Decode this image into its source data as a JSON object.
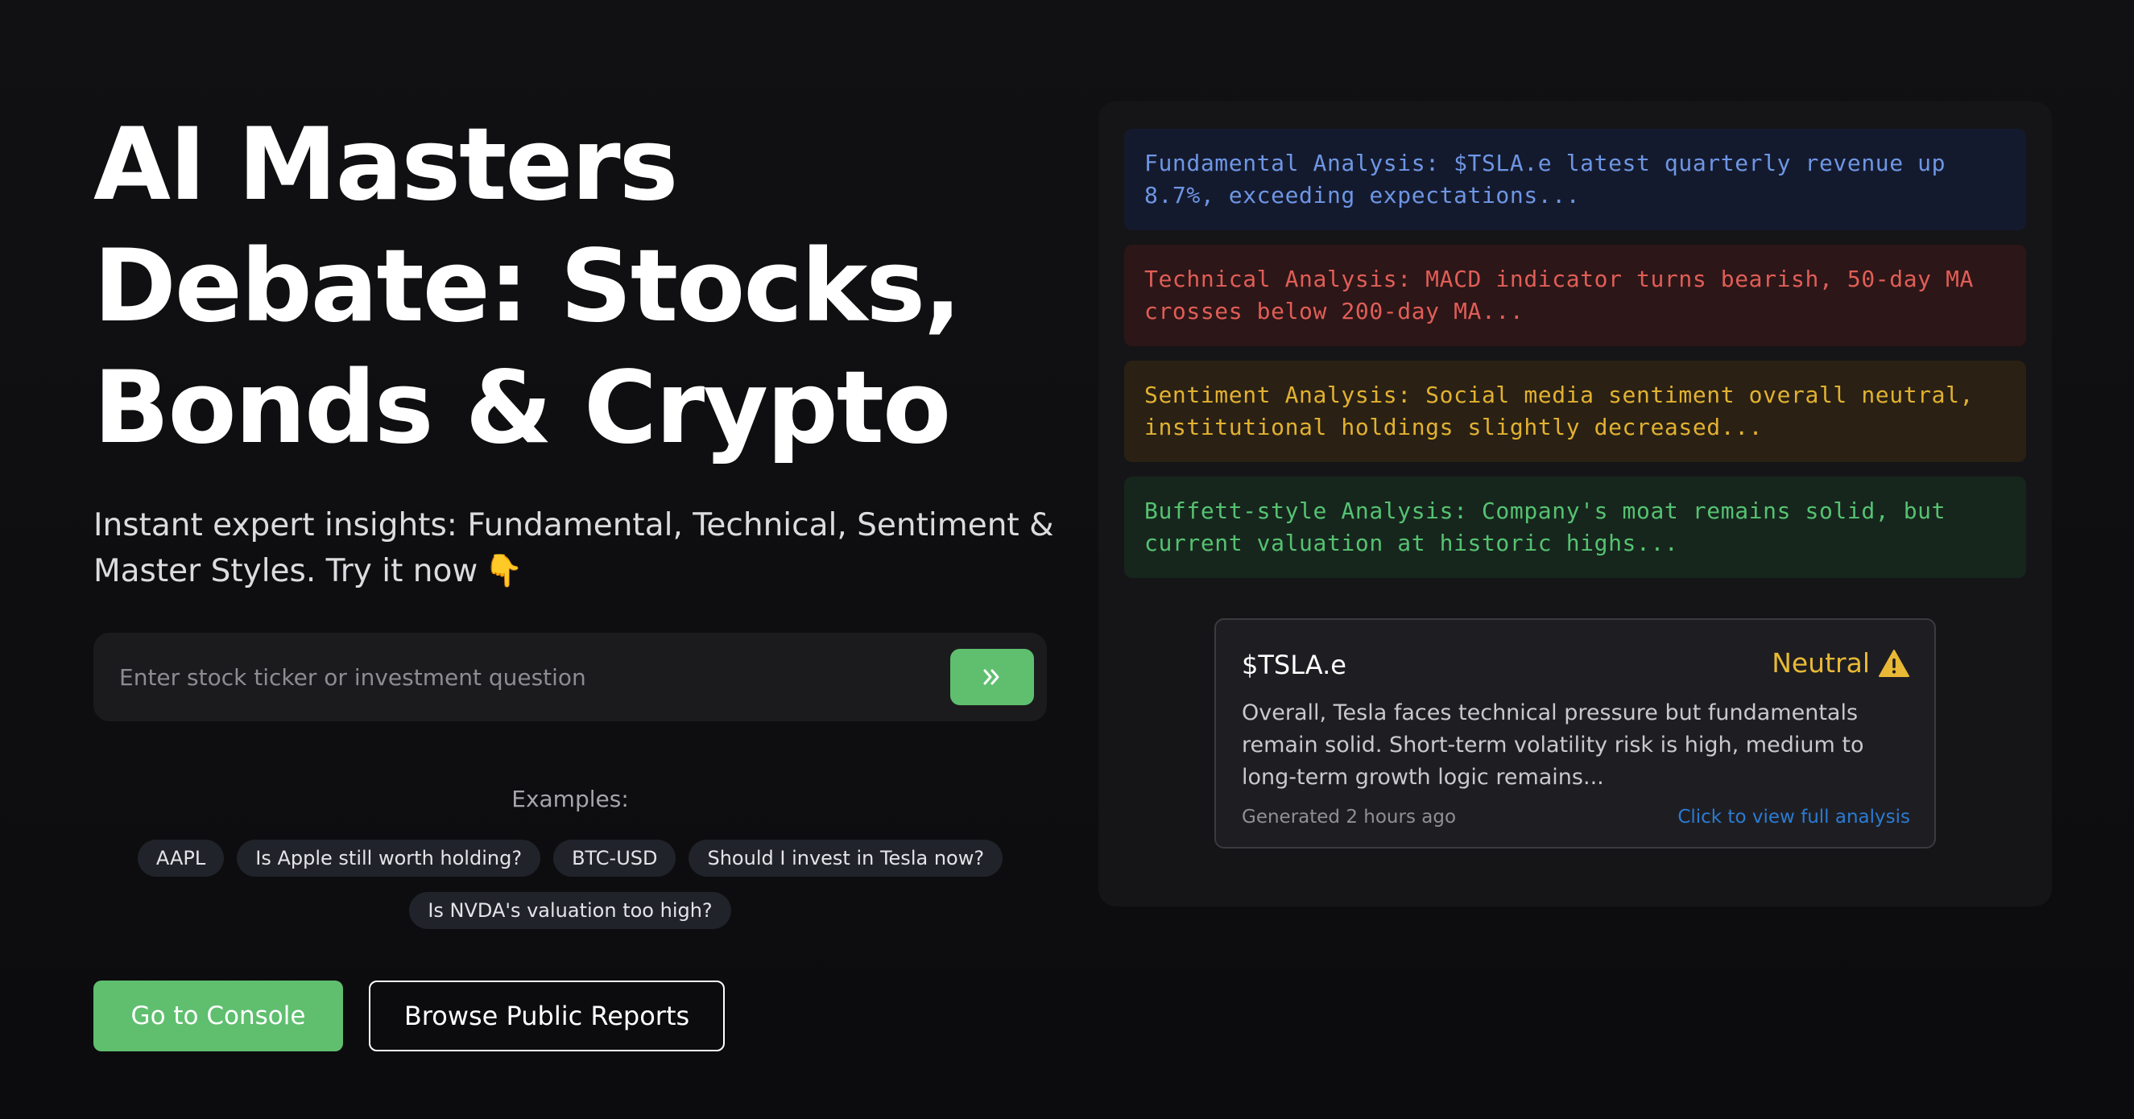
{
  "hero": {
    "title": "AI Masters Debate: Stocks, Bonds & Crypto",
    "subtitle": "Instant expert insights: Fundamental, Technical, Sentiment & Master Styles. Try it now",
    "subtitle_emoji": "👇"
  },
  "search": {
    "placeholder": "Enter stock ticker or investment question",
    "submit_icon": "double-chevron-right-icon"
  },
  "examples": {
    "label": "Examples:",
    "chips": [
      "AAPL",
      "Is Apple still worth holding?",
      "BTC-USD",
      "Should I invest in Tesla now?",
      "Is NVDA's valuation too high?"
    ]
  },
  "actions": {
    "primary_label": "Go to Console",
    "secondary_label": "Browse Public Reports"
  },
  "analysis_cards": [
    {
      "text": "Fundamental Analysis: $TSLA.e latest quarterly revenue up\n8.7%, exceeding expectations...",
      "color": "#6e96e4",
      "background": "#141a2e"
    },
    {
      "text": "Technical Analysis: MACD indicator turns bearish, 50-day MA\ncrosses below 200-day MA...",
      "color": "#e05e57",
      "background": "#2d1617"
    },
    {
      "text": "Sentiment Analysis: Social media sentiment overall neutral,\ninstitutional holdings slightly decreased...",
      "color": "#e2b131",
      "background": "#2a2114"
    },
    {
      "text": "Buffett-style Analysis: Company's moat remains solid, but\ncurrent valuation at historic highs...",
      "color": "#56c271",
      "background": "#16261d"
    }
  ],
  "summary": {
    "ticker": "$TSLA.e",
    "rating": "Neutral",
    "rating_icon": "warning-icon",
    "rating_color": "#e9b935",
    "text": "Overall, Tesla faces technical pressure but fundamentals remain solid. Short-term volatility risk is high, medium to long-term growth logic remains...",
    "generated": "Generated 2 hours ago",
    "link": "Click to view full analysis"
  },
  "colors": {
    "accent": "#5fbf6f",
    "background": "#111113",
    "link": "#2b7bd3"
  }
}
